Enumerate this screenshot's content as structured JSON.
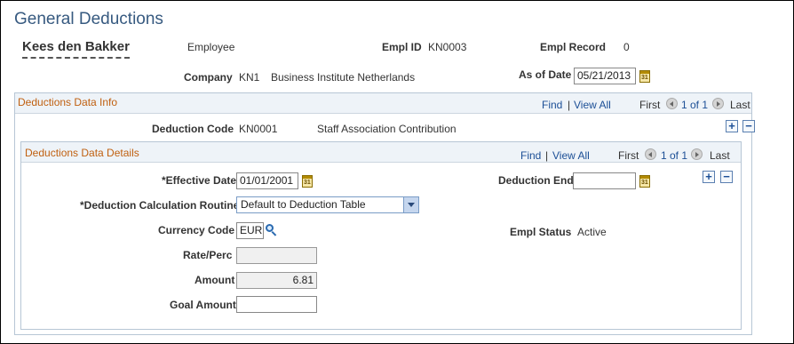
{
  "page_title": "General Deductions",
  "employee": {
    "name": "Kees den Bakker",
    "role": "Employee",
    "empl_id_label": "Empl ID",
    "empl_id": "KN0003",
    "empl_record_label": "Empl Record",
    "empl_record": "0",
    "company_label": "Company",
    "company_code": "KN1",
    "company_name": "Business Institute Netherlands",
    "as_of_date_label": "As of Date",
    "as_of_date": "05/21/2013"
  },
  "deductions_info": {
    "section_title": "Deductions Data Info",
    "nav": {
      "find": "Find",
      "separator": "|",
      "view_all": "View All",
      "first": "First",
      "range": "1 of 1",
      "last": "Last"
    },
    "deduction_code_label": "Deduction Code",
    "deduction_code": "KN0001",
    "deduction_description": "Staff Association Contribution",
    "add_label": "+",
    "remove_label": "−"
  },
  "deductions_details": {
    "section_title": "Deductions Data Details",
    "nav": {
      "find": "Find",
      "separator": "|",
      "view_all": "View All",
      "first": "First",
      "range": "1 of 1",
      "last": "Last"
    },
    "effective_date_label": "*Effective Date",
    "effective_date": "01/01/2001",
    "deduction_end_label": "Deduction End",
    "deduction_end": "",
    "calc_routine_label": "*Deduction Calculation Routine",
    "calc_routine_value": "Default to Deduction Table",
    "currency_code_label": "Currency Code",
    "currency_code": "EUR",
    "empl_status_label": "Empl Status",
    "empl_status": "Active",
    "rate_perc_label": "Rate/Perc",
    "rate_perc": "",
    "amount_label": "Amount",
    "amount": "6.81",
    "goal_amount_label": "Goal Amount",
    "goal_amount": "",
    "add_label": "+",
    "remove_label": "−"
  },
  "icons": {
    "calendar": "calendar-icon",
    "lookup": "magnifier-icon",
    "prev": "previous-arrow-icon",
    "next": "next-arrow-icon",
    "calendar_glyph": "31"
  },
  "colors": {
    "title": "#375a80",
    "section": "#c06010",
    "link": "#1c4f96"
  }
}
